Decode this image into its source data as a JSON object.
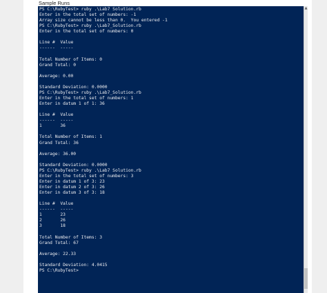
{
  "caption": "Sample Runs",
  "terminal": {
    "lines": [
      "PS C:\\RubyTest> ruby .\\Lab7 Solution.rb",
      "Enter in the total set of numbers: -1",
      "Array size cannot be less than 0.  You entered -1",
      "PS C:\\RubyTest> ruby .\\Lab7_Solution.rb",
      "Enter in the total set of numbers: 0",
      "",
      "Line #  Value",
      "------  -----",
      "",
      "Total Number of Items: 0",
      "Grand Total: 0",
      "",
      "Average: 0.00",
      "",
      "Standard Deviation: 0.0000",
      "PS C:\\RubyTest> ruby .\\Lab7_Solution.rb",
      "Enter in the total set of numbers: 1",
      "Enter in datum 1 of 1: 36",
      "",
      "Line #  Value",
      "------  -----",
      "1       36",
      "",
      "Total Number of Items: 1",
      "Grand Total: 36",
      "",
      "Average: 36.00",
      "",
      "Standard Deviation: 0.0000",
      "PS C:\\RubyTest> ruby .\\Lab7 Solution.rb",
      "Enter in the total set of numbers: 3",
      "Enter in datum 1 of 3: 23",
      "Enter in datum 2 of 3: 26",
      "Enter in datum 3 of 3: 18",
      "",
      "Line #  Value",
      "------  -----",
      "1       23",
      "2       26",
      "3       18",
      "",
      "Total Number of Items: 3",
      "Grand Total: 67",
      "",
      "Average: 22.33",
      "",
      "Standard Deviation: 4.0415",
      "PS C:\\RubyTest>"
    ],
    "background_color": "#012456",
    "text_color": "#eeedf0"
  },
  "scrollbar": {
    "up_arrow_icon": "scroll-up-arrow-icon"
  }
}
